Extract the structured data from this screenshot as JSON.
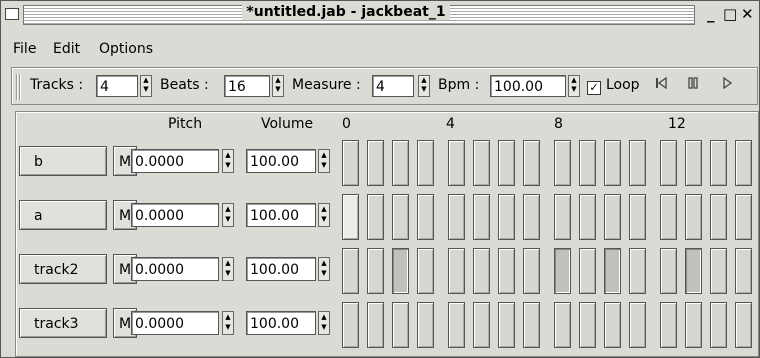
{
  "window": {
    "title": "*untitled.jab - jackbeat_1",
    "minimize_glyph": "_",
    "maximize_glyph": "□",
    "close_glyph": "✕"
  },
  "menubar": {
    "file": "File",
    "edit": "Edit",
    "options": "Options"
  },
  "toolbar": {
    "tracks_label": "Tracks :",
    "tracks_value": "4",
    "beats_label": "Beats :",
    "beats_value": "16",
    "measure_label": "Measure :",
    "measure_value": "4",
    "bpm_label": "Bpm :",
    "bpm_value": "100.00",
    "loop_label": "Loop",
    "loop_checked": true,
    "rewind_icon": "rewind-icon",
    "pause_icon": "pause-icon",
    "play_icon": "play-icon"
  },
  "grid": {
    "headers": {
      "pitch": "Pitch",
      "volume": "Volume"
    },
    "beat_markers": [
      "0",
      "4",
      "8",
      "12"
    ],
    "beats_per_track": 16,
    "tracks": [
      {
        "name": "b",
        "mute_label": "M",
        "pitch": "0.0000",
        "volume": "100.00",
        "active_beats": []
      },
      {
        "name": "a",
        "mute_label": "M",
        "pitch": "0.0000",
        "volume": "100.00",
        "active_beats": []
      },
      {
        "name": "track2",
        "mute_label": "M",
        "pitch": "0.0000",
        "volume": "100.00",
        "active_beats": [
          2,
          8,
          10,
          13
        ]
      },
      {
        "name": "track3",
        "mute_label": "M",
        "pitch": "0.0000",
        "volume": "100.00",
        "active_beats": []
      }
    ]
  },
  "colors": {
    "window_bg": "#dcdad5",
    "beat_on": "#c2c0bb",
    "field_bg": "#ffffff"
  }
}
